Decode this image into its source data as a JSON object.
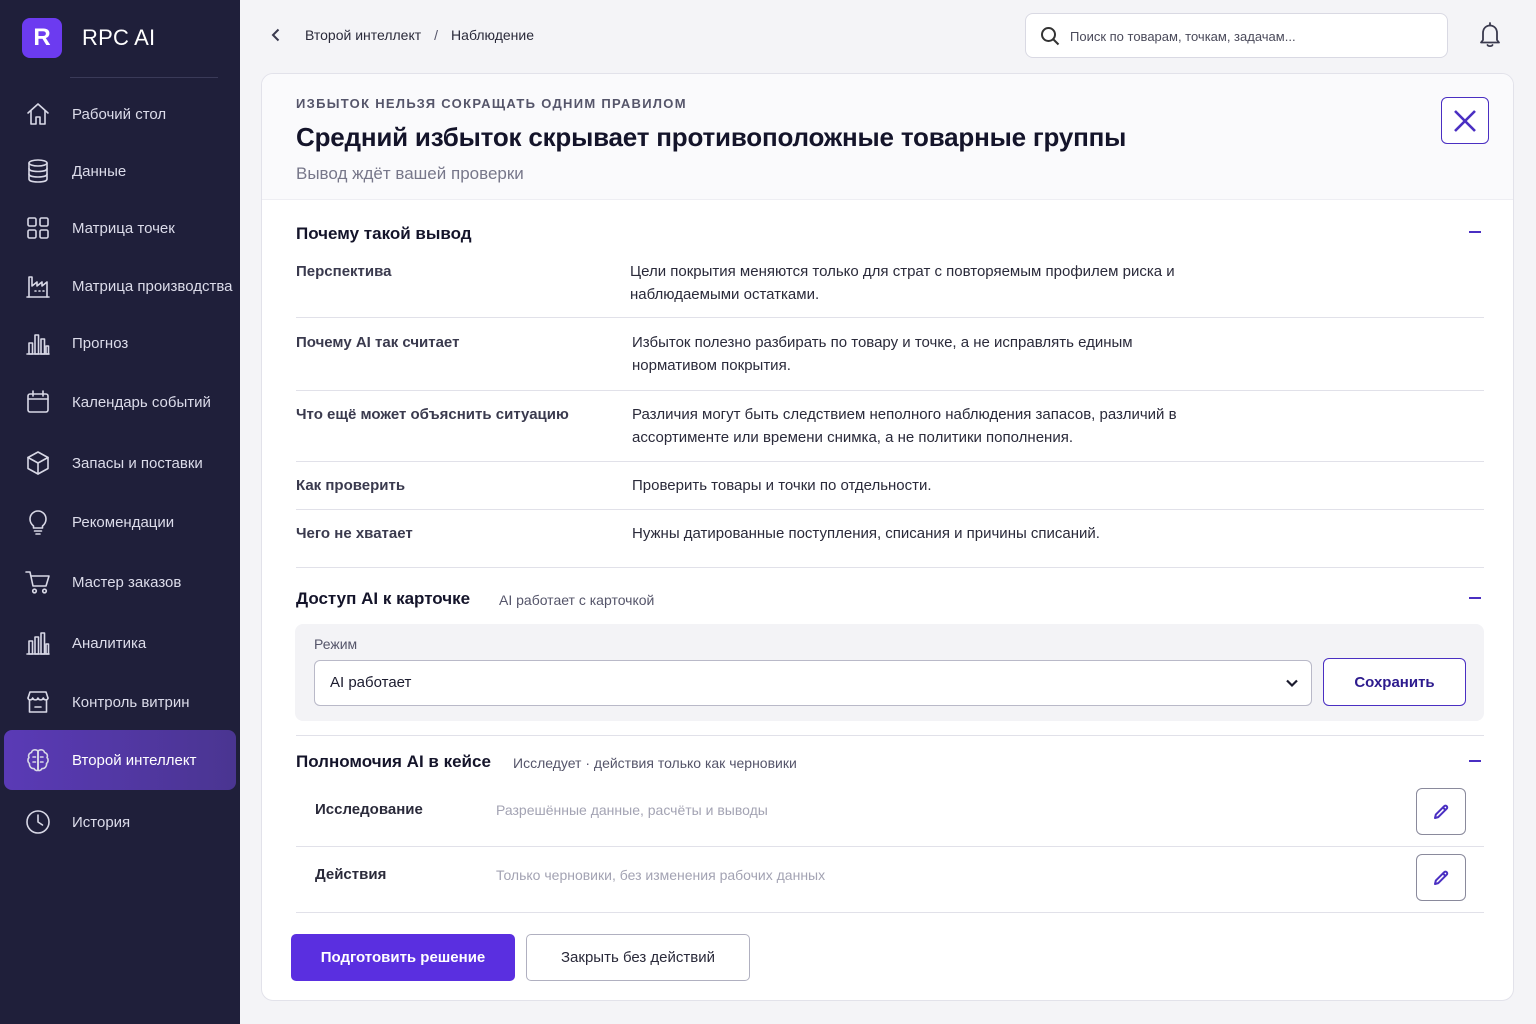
{
  "app": {
    "logo_letter": "R",
    "name": "RPC AI"
  },
  "sidebar": {
    "items": [
      {
        "label": "Рабочий стол",
        "icon": "home-icon"
      },
      {
        "label": "Данные",
        "icon": "database-icon"
      },
      {
        "label": "Матрица точек",
        "icon": "grid-icon"
      },
      {
        "label": "Матрица производства",
        "icon": "factory-icon"
      },
      {
        "label": "Прогноз",
        "icon": "bar-chart-icon"
      },
      {
        "label": "Календарь событий",
        "icon": "calendar-icon"
      },
      {
        "label": "Запасы и поставки",
        "icon": "box-icon"
      },
      {
        "label": "Рекомендации",
        "icon": "lightbulb-icon"
      },
      {
        "label": "Мастер заказов",
        "icon": "cart-icon"
      },
      {
        "label": "Аналитика",
        "icon": "analytics-icon"
      },
      {
        "label": "Контроль витрин",
        "icon": "storefront-icon"
      },
      {
        "label": "Второй интеллект",
        "icon": "brain-icon",
        "active": true
      },
      {
        "label": "История",
        "icon": "clock-icon"
      }
    ]
  },
  "topbar": {
    "breadcrumb": [
      "Второй интеллект",
      "Наблюдение"
    ],
    "breadcrumb_separator": "/",
    "search_placeholder": "Поиск по товарам, точкам, задачам..."
  },
  "card": {
    "eyebrow": "ИЗБЫТОК НЕЛЬЗЯ СОКРАЩАТЬ ОДНИМ ПРАВИЛОМ",
    "title": "Средний избыток скрывает противоположные товарные группы",
    "subtitle": "Вывод ждёт вашей проверки"
  },
  "reasoning": {
    "title": "Почему такой вывод",
    "rows": [
      {
        "key": "Перспектива",
        "value": "Цели покрытия меняются только для страт с повторяемым профилем риска и наблюдаемыми остатками."
      },
      {
        "key": "Почему AI так считает",
        "value": "Избыток полезно разбирать по товару и точке, а не исправлять единым нормативом покрытия."
      },
      {
        "key": "Что ещё может объяснить ситуацию",
        "value": "Различия могут быть следствием неполного наблюдения запасов, различий в ассортименте или времени снимка, а не политики пополнения."
      },
      {
        "key": "Как проверить",
        "value": "Проверить товары и точки по отдельности."
      },
      {
        "key": "Чего не хватает",
        "value": "Нужны датированные поступления, списания и причины списаний."
      }
    ]
  },
  "access": {
    "title": "Доступ AI к карточке",
    "meta": "AI работает с карточкой",
    "mode_label": "Режим",
    "mode_value": "AI работает",
    "save_label": "Сохранить"
  },
  "permissions": {
    "title": "Полномочия AI в кейсе",
    "meta": "Исследует · действия только как черновики",
    "rows": [
      {
        "key": "Исследование",
        "value": "Разрешённые данные, расчёты и выводы"
      },
      {
        "key": "Действия",
        "value": "Только черновики, без изменения рабочих данных"
      }
    ]
  },
  "actions": {
    "primary": "Подготовить решение",
    "secondary": "Закрыть без действий"
  },
  "colors": {
    "accent": "#5a2fe0",
    "sidebar_bg": "#1f1f3a",
    "active_item": "#5a3ab6"
  }
}
